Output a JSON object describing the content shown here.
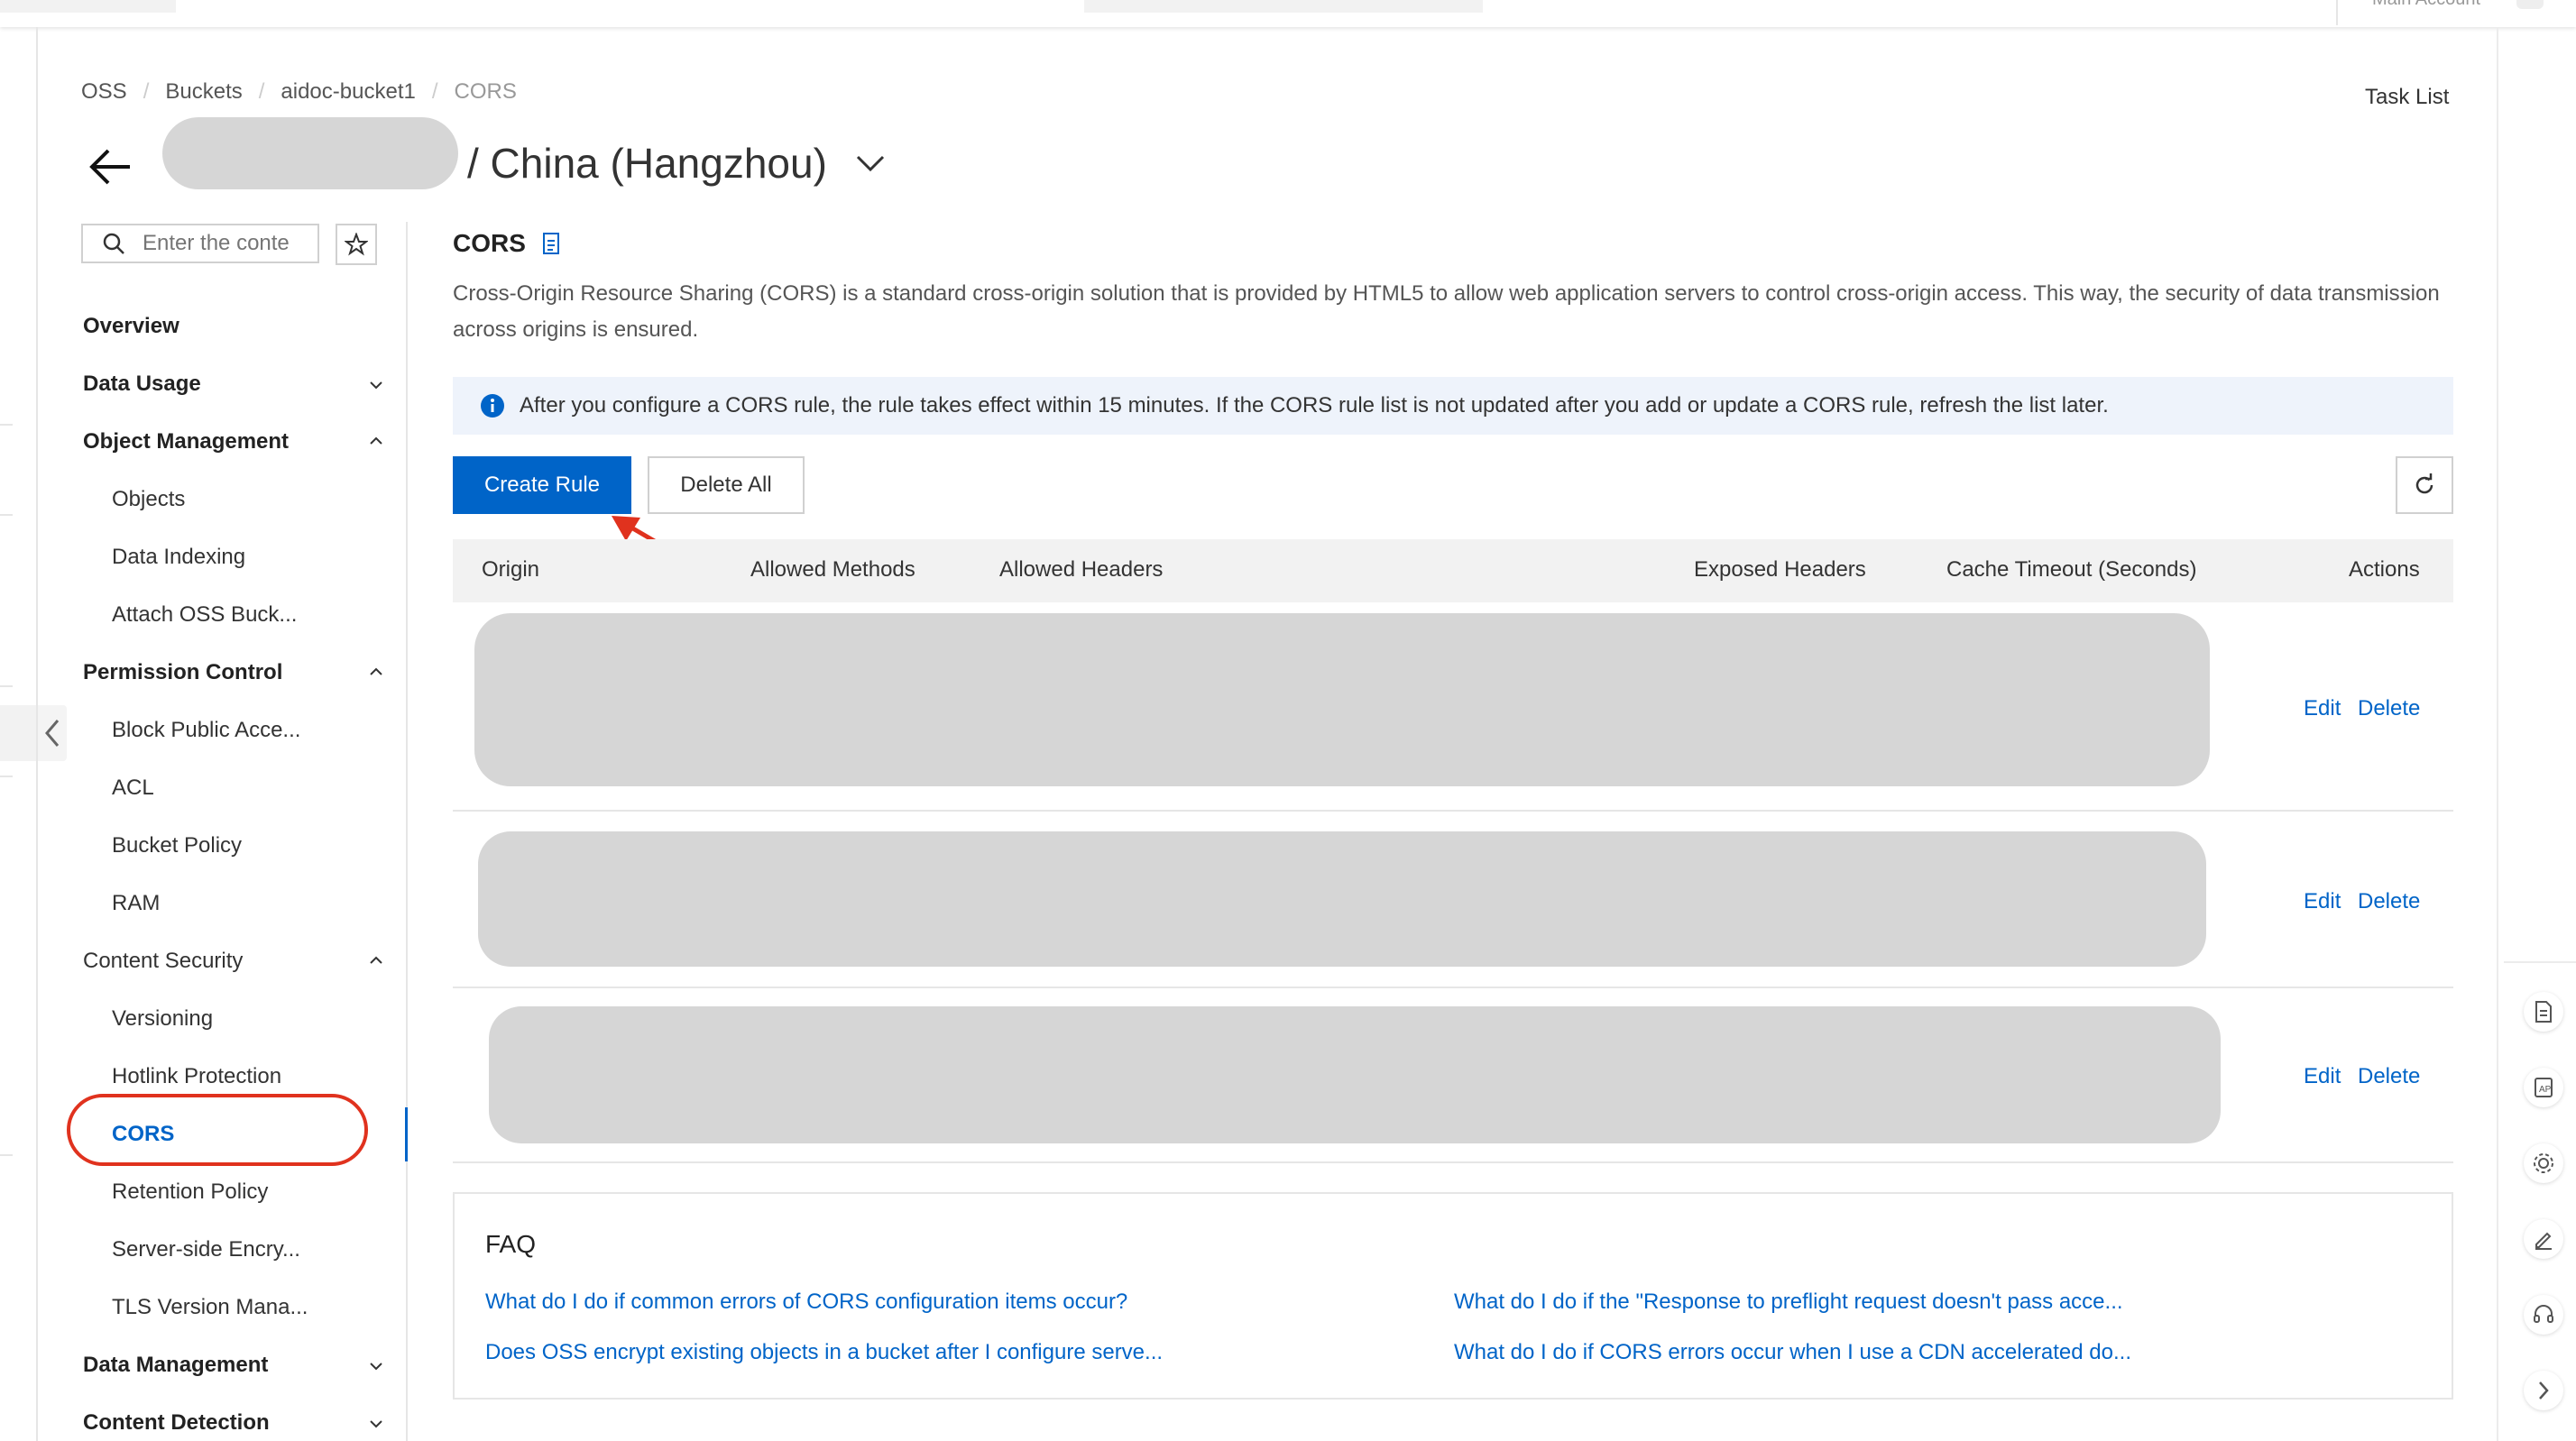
{
  "topbar": {
    "account_label": "Main Account"
  },
  "breadcrumb": [
    "OSS",
    "Buckets",
    "aidoc-bucket1",
    "CORS"
  ],
  "task_list": "Task List",
  "header": {
    "region_title": "/ China (Hangzhou)"
  },
  "search": {
    "placeholder": "Enter the conte"
  },
  "sidebar": {
    "items": [
      {
        "label": "Overview",
        "kind": "group"
      },
      {
        "label": "Data Usage",
        "kind": "group",
        "chevron": "down"
      },
      {
        "label": "Object Management",
        "kind": "group",
        "chevron": "up"
      },
      {
        "label": "Objects",
        "kind": "sub"
      },
      {
        "label": "Data Indexing",
        "kind": "sub"
      },
      {
        "label": "Attach OSS Buck...",
        "kind": "sub"
      },
      {
        "label": "Permission Control",
        "kind": "group",
        "chevron": "up"
      },
      {
        "label": "Block Public Acce...",
        "kind": "sub"
      },
      {
        "label": "ACL",
        "kind": "sub"
      },
      {
        "label": "Bucket Policy",
        "kind": "sub"
      },
      {
        "label": "RAM",
        "kind": "sub"
      },
      {
        "label": "Content Security",
        "kind": "group-normal",
        "chevron": "up"
      },
      {
        "label": "Versioning",
        "kind": "sub"
      },
      {
        "label": "Hotlink Protection",
        "kind": "sub"
      },
      {
        "label": "CORS",
        "kind": "sub",
        "active": true
      },
      {
        "label": "Retention Policy",
        "kind": "sub"
      },
      {
        "label": "Server-side Encry...",
        "kind": "sub"
      },
      {
        "label": "TLS Version Mana...",
        "kind": "sub"
      },
      {
        "label": "Data Management",
        "kind": "group",
        "chevron": "down"
      },
      {
        "label": "Content Detection",
        "kind": "group",
        "chevron": "down"
      }
    ]
  },
  "main": {
    "title": "CORS",
    "description": "Cross-Origin Resource Sharing (CORS) is a standard cross-origin solution that is provided by HTML5 to allow web application servers to control cross-origin access. This way, the security of data transmission across origins is ensured.",
    "notice": "After you configure a CORS rule, the rule takes effect within 15 minutes. If the CORS rule list is not updated after you add or update a CORS rule, refresh the list later.",
    "buttons": {
      "create": "Create Rule",
      "delete_all": "Delete All"
    },
    "table": {
      "columns": [
        "Origin",
        "Allowed Methods",
        "Allowed Headers",
        "Exposed Headers",
        "Cache Timeout (Seconds)",
        "Actions"
      ],
      "row_actions": {
        "edit": "Edit",
        "delete": "Delete"
      }
    },
    "faq": {
      "title": "FAQ",
      "links": [
        "What do I do if common errors of CORS configuration items occur?",
        "What do I do if the \"Response to preflight request doesn't pass acce...",
        "Does OSS encrypt existing objects in a bucket after I configure serve...",
        "What do I do if CORS errors occur when I use a CDN accelerated do..."
      ]
    }
  },
  "colors": {
    "primary": "#0064c8",
    "annotation": "#e0321e",
    "notice_bg": "#eef3fb"
  },
  "icons": [
    "back-arrow-icon",
    "chevron-down-icon",
    "search-icon",
    "star-icon",
    "document-icon",
    "info-icon",
    "refresh-icon",
    "chevron-left-icon",
    "gear-icon",
    "edit-icon",
    "headset-icon",
    "chevron-right-icon"
  ]
}
